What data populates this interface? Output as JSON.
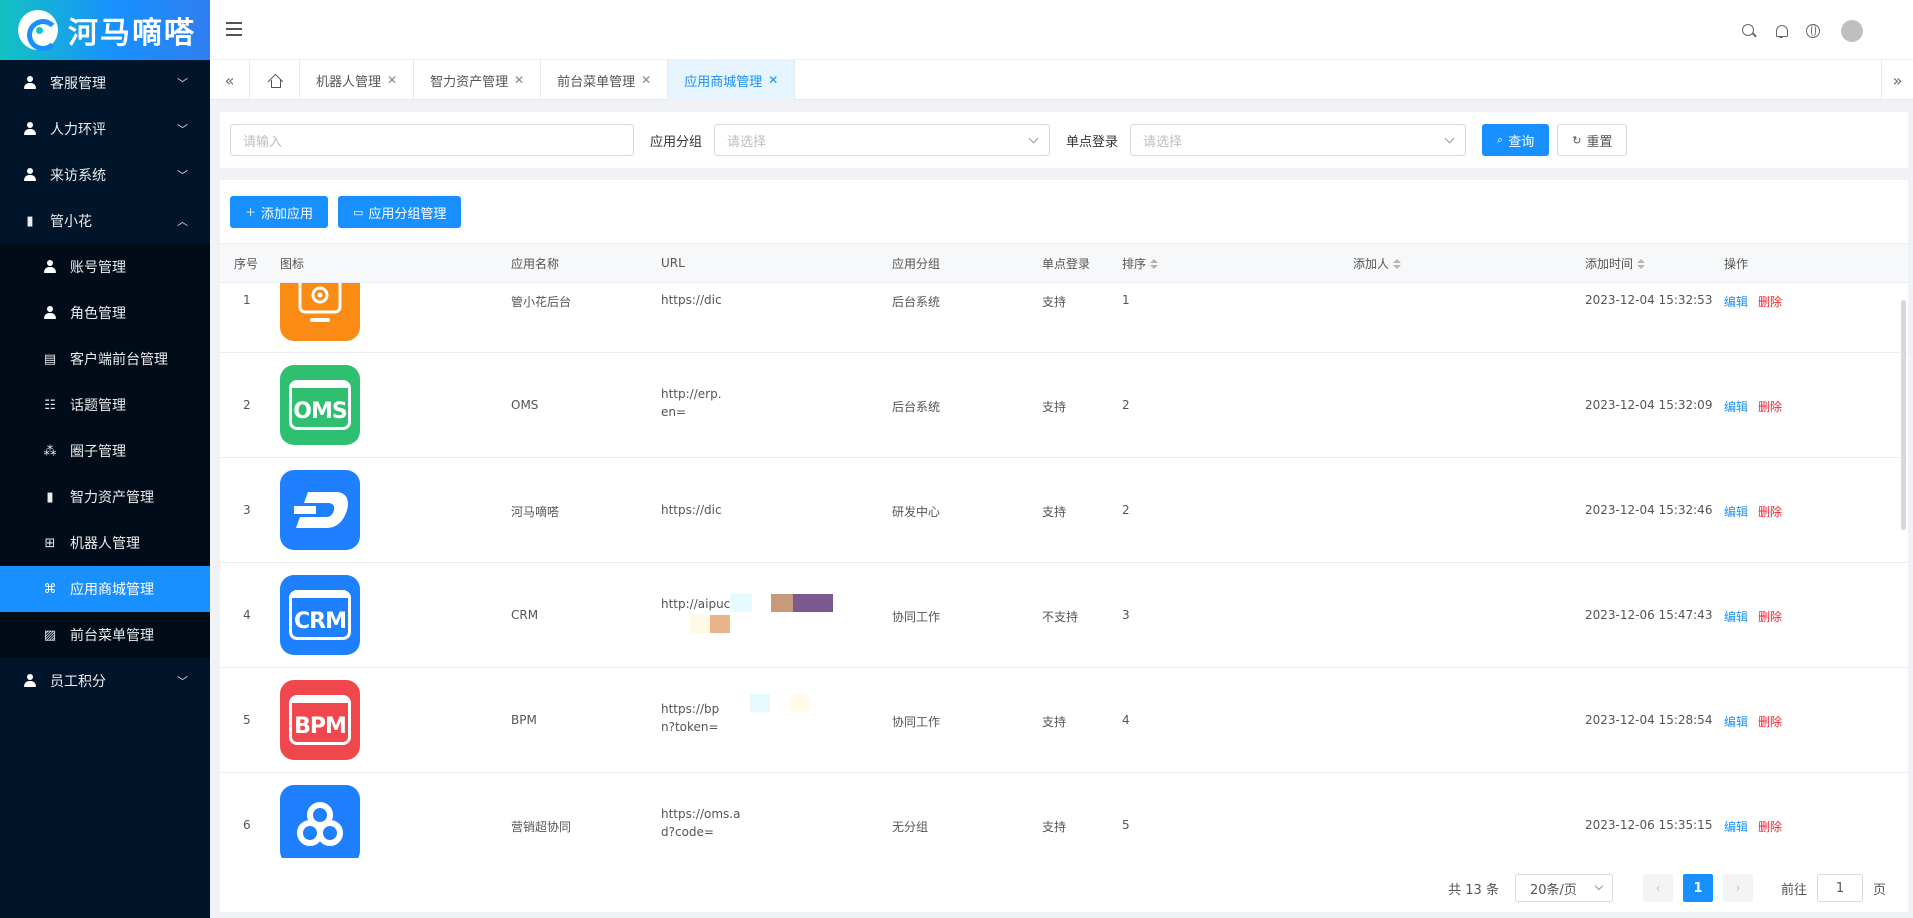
{
  "brand": {
    "name": "河马嘀嗒"
  },
  "sidebar": {
    "items": [
      {
        "label": "客服管理",
        "icon": "user-icon",
        "expandable": true
      },
      {
        "label": "人力环评",
        "icon": "user-icon",
        "expandable": true
      },
      {
        "label": "来访系统",
        "icon": "user-icon",
        "expandable": true
      },
      {
        "label": "管小花",
        "icon": "book-icon",
        "expandable": true,
        "expanded": true
      }
    ],
    "sub_items": [
      {
        "label": "账号管理",
        "icon": "user-icon"
      },
      {
        "label": "角色管理",
        "icon": "user-icon"
      },
      {
        "label": "客户端前台管理",
        "icon": "message-icon"
      },
      {
        "label": "话题管理",
        "icon": "table-icon"
      },
      {
        "label": "圈子管理",
        "icon": "circles-icon"
      },
      {
        "label": "智力资产管理",
        "icon": "book-icon"
      },
      {
        "label": "机器人管理",
        "icon": "org-icon"
      },
      {
        "label": "应用商城管理",
        "icon": "app-grid-icon",
        "active": true
      },
      {
        "label": "前台菜单管理",
        "icon": "image-icon"
      }
    ],
    "last_item": {
      "label": "员工积分",
      "icon": "group-icon",
      "expandable": true
    }
  },
  "tabs": [
    {
      "label": "机器人管理"
    },
    {
      "label": "智力资产管理"
    },
    {
      "label": "前台菜单管理"
    },
    {
      "label": "应用商城管理",
      "active": true
    }
  ],
  "search": {
    "keyword_placeholder": "请输入",
    "group_label": "应用分组",
    "group_placeholder": "请选择",
    "sso_label": "单点登录",
    "sso_placeholder": "请选择",
    "query_label": "查询",
    "reset_label": "重置"
  },
  "toolbar": {
    "add_label": "添加应用",
    "group_manage_label": "应用分组管理"
  },
  "table": {
    "columns": {
      "index": "序号",
      "icon": "图标",
      "name": "应用名称",
      "url": "URL",
      "group": "应用分组",
      "sso": "单点登录",
      "sort": "排序",
      "adder": "添加人",
      "added_time": "添加时间",
      "actions": "操作"
    },
    "rows": [
      {
        "index": "1",
        "icon": "gear-monitor-icon",
        "icon_color": "#fa8c16",
        "icon_text": "",
        "name": "管小花后台",
        "url_line1": "https://dic",
        "url_line2": "",
        "group": "后台系统",
        "sso": "支持",
        "sort": "1",
        "adder": "",
        "added_time": "2023-12-04 15:32:53"
      },
      {
        "index": "2",
        "icon": "oms-icon",
        "icon_color": "#2fbf71",
        "icon_text": "OMS",
        "name": "OMS",
        "url_line1": "http://erp.",
        "url_line2": "en=",
        "group": "后台系统",
        "sso": "支持",
        "sort": "2",
        "adder": "",
        "added_time": "2023-12-04 15:32:09"
      },
      {
        "index": "3",
        "icon": "dash-icon",
        "icon_color": "#1e80ff",
        "icon_text": "",
        "name": "河马嘀嗒",
        "url_line1": "https://dic",
        "url_line2": "",
        "group": "研发中心",
        "sso": "支持",
        "sort": "2",
        "adder": "",
        "added_time": "2023-12-04 15:32:46"
      },
      {
        "index": "4",
        "icon": "crm-icon",
        "icon_color": "#1e80ff",
        "icon_text": "CRM",
        "name": "CRM",
        "url_line1": "http://aipucrn",
        "url_line2": "",
        "group": "协同工作",
        "sso": "不支持",
        "sort": "3",
        "adder": "",
        "added_time": "2023-12-06 15:47:43"
      },
      {
        "index": "5",
        "icon": "bpm-icon",
        "icon_color": "#f0474e",
        "icon_text": "BPM",
        "name": "BPM",
        "url_line1": "https://bp",
        "url_line2": "n?token=",
        "group": "协同工作",
        "sso": "支持",
        "sort": "4",
        "adder": "",
        "added_time": "2023-12-04 15:28:54"
      },
      {
        "index": "6",
        "icon": "link-knot-icon",
        "icon_color": "#1e80ff",
        "icon_text": "",
        "name": "营销超协同",
        "url_line1": "https://oms.a",
        "url_line2": "d?code=",
        "group": "无分组",
        "sso": "支持",
        "sort": "5",
        "adder": "",
        "added_time": "2023-12-06 15:35:15"
      }
    ],
    "edit_label": "编辑",
    "delete_label": "删除"
  },
  "pagination": {
    "total_text": "共 13 条",
    "page_size": "20条/页",
    "current_page": "1",
    "goto_label": "前往",
    "goto_value": "1",
    "page_unit": "页"
  },
  "colors": {
    "primary": "#1890ff",
    "danger": "#f5222d",
    "sidebar_bg": "#001529"
  }
}
